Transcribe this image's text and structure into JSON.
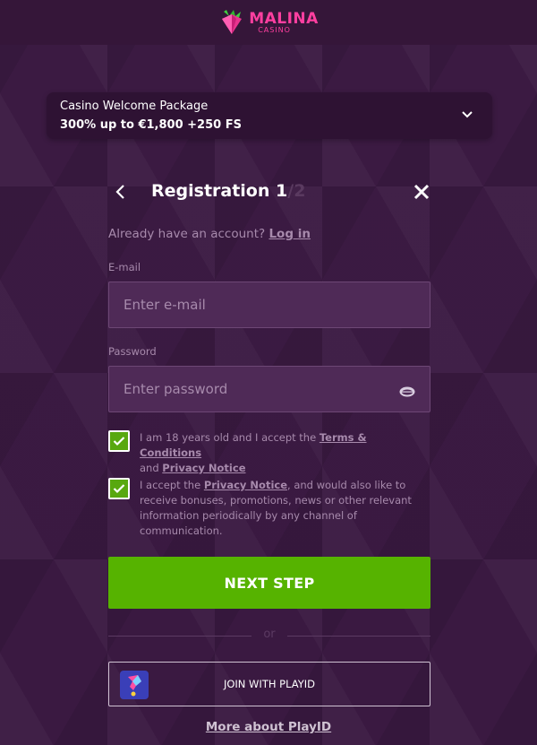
{
  "brand": {
    "name": "MALINA",
    "tagline": "CASINO"
  },
  "promo": {
    "title": "Casino Welcome Package",
    "offer": "300% up to €1,800 +250 FS"
  },
  "registration": {
    "title": "Registration",
    "step": "1",
    "total": "/2"
  },
  "account": {
    "prompt": "Already have an account?",
    "login_link": "Log in"
  },
  "form": {
    "email_label": "E-mail",
    "email_placeholder": "Enter e-mail",
    "password_label": "Password",
    "password_placeholder": "Enter password"
  },
  "consents": {
    "age_text_prefix": "I am 18 years old and I accept the",
    "terms_link": "Terms & Conditions",
    "and": "and",
    "privacy_link": "Privacy Notice",
    "marketing_prefix": "I accept the",
    "marketing_privacy_link": "Privacy Notice",
    "marketing_suffix": ", and would also like to receive bonuses, promotions, news or other relevant information periodically by any channel of communication."
  },
  "actions": {
    "next_step": "NEXT STEP",
    "or": "or",
    "playid": "JOIN WITH PLAYID",
    "more_playid": "More about PlayID"
  },
  "colors": {
    "background": "#3a1a41",
    "primary_button": "#56b300",
    "brand_pink": "#ff3fa0",
    "muted_text": "#a78aac"
  },
  "icons": {
    "logo": "raspberry-gem-icon",
    "promo_toggle": "chevron-down-icon",
    "back": "chevron-left-icon",
    "close": "close-icon",
    "password_toggle": "eye-icon",
    "checkbox": "check-icon",
    "playid": "playid-logo-icon"
  }
}
